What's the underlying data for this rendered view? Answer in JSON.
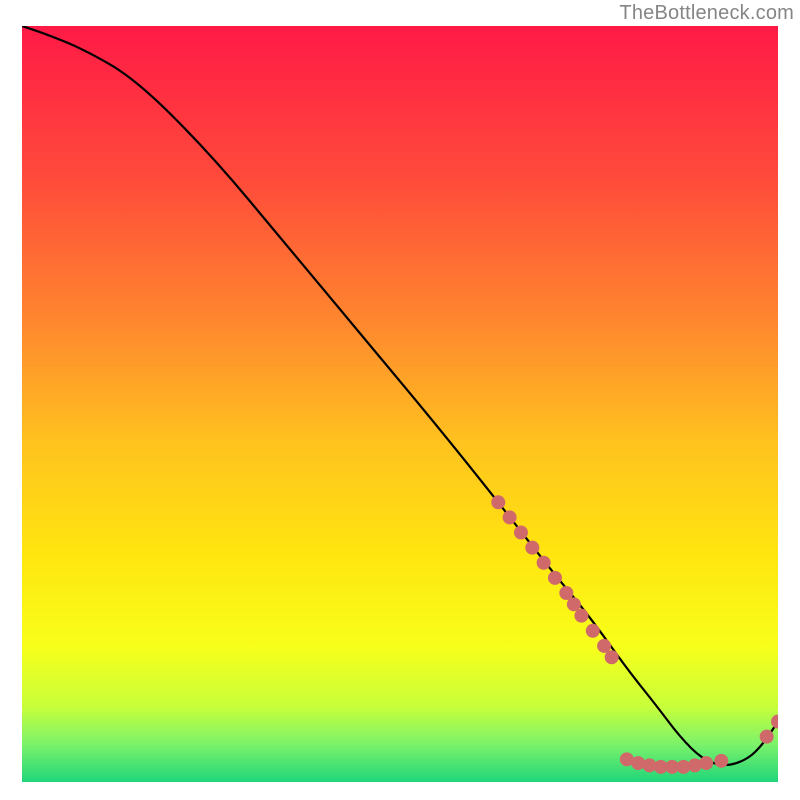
{
  "attribution": "TheBottleneck.com",
  "chart_data": {
    "type": "line",
    "title": "",
    "xlabel": "",
    "ylabel": "",
    "xlim": [
      0,
      100
    ],
    "ylim": [
      0,
      100
    ],
    "series": [
      {
        "name": "curve",
        "x": [
          0,
          3,
          8,
          15,
          25,
          35,
          45,
          55,
          63,
          70,
          75,
          80,
          84,
          87,
          90,
          93,
          96,
          98,
          100
        ],
        "y": [
          100,
          99,
          97,
          93,
          83,
          71,
          59,
          47,
          37,
          28,
          22,
          15,
          10,
          6,
          3,
          2,
          3,
          5,
          8
        ]
      }
    ],
    "scatter_points": [
      {
        "x": 63.0,
        "y": 37.0
      },
      {
        "x": 64.5,
        "y": 35.0
      },
      {
        "x": 66.0,
        "y": 33.0
      },
      {
        "x": 67.5,
        "y": 31.0
      },
      {
        "x": 69.0,
        "y": 29.0
      },
      {
        "x": 70.5,
        "y": 27.0
      },
      {
        "x": 72.0,
        "y": 25.0
      },
      {
        "x": 73.0,
        "y": 23.5
      },
      {
        "x": 74.0,
        "y": 22.0
      },
      {
        "x": 75.5,
        "y": 20.0
      },
      {
        "x": 77.0,
        "y": 18.0
      },
      {
        "x": 78.0,
        "y": 16.5
      },
      {
        "x": 80.0,
        "y": 3.0
      },
      {
        "x": 81.5,
        "y": 2.5
      },
      {
        "x": 83.0,
        "y": 2.2
      },
      {
        "x": 84.5,
        "y": 2.0
      },
      {
        "x": 86.0,
        "y": 2.0
      },
      {
        "x": 87.5,
        "y": 2.0
      },
      {
        "x": 89.0,
        "y": 2.2
      },
      {
        "x": 90.5,
        "y": 2.5
      },
      {
        "x": 92.5,
        "y": 2.8
      },
      {
        "x": 98.5,
        "y": 6.0
      },
      {
        "x": 100.0,
        "y": 8.0
      }
    ],
    "gradient_stops": [
      {
        "offset": 0.0,
        "color": "#ff1a46"
      },
      {
        "offset": 0.2,
        "color": "#ff4a3b"
      },
      {
        "offset": 0.4,
        "color": "#ff8a2e"
      },
      {
        "offset": 0.55,
        "color": "#ffc21f"
      },
      {
        "offset": 0.7,
        "color": "#ffe60f"
      },
      {
        "offset": 0.82,
        "color": "#f8ff1a"
      },
      {
        "offset": 0.9,
        "color": "#c8ff3a"
      },
      {
        "offset": 0.95,
        "color": "#7cf26a"
      },
      {
        "offset": 1.0,
        "color": "#1fd67a"
      }
    ],
    "curve_color": "#000000",
    "point_color": "#d06a6a",
    "point_radius": 7
  }
}
